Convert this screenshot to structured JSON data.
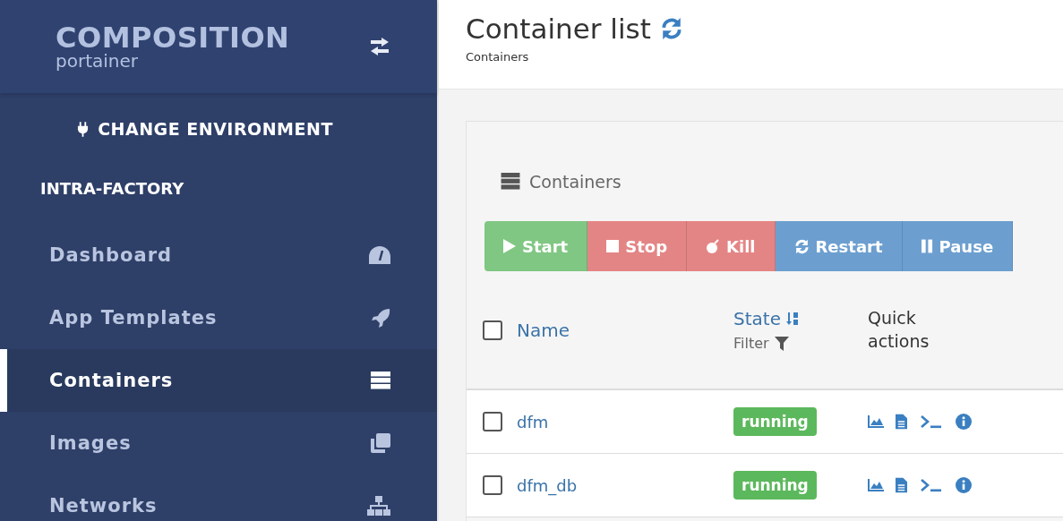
{
  "sidebar": {
    "brand": "COMPOSITION",
    "product": "portainer",
    "change_environment": "CHANGE ENVIRONMENT",
    "environment": "INTRA-FACTORY",
    "items": [
      {
        "label": "Dashboard",
        "kind": "gauge",
        "selected": false
      },
      {
        "label": "App Templates",
        "kind": "rocket",
        "selected": false
      },
      {
        "label": "Containers",
        "kind": "server",
        "selected": true
      },
      {
        "label": "Images",
        "kind": "clone",
        "selected": false
      },
      {
        "label": "Networks",
        "kind": "sitemap",
        "selected": false
      }
    ]
  },
  "header": {
    "title": "Container list",
    "breadcrumb": "Containers"
  },
  "card": {
    "title": "Containers",
    "buttons": [
      {
        "label": "Start",
        "kind": "start"
      },
      {
        "label": "Stop",
        "kind": "stop"
      },
      {
        "label": "Kill",
        "kind": "kill"
      },
      {
        "label": "Restart",
        "kind": "restart"
      },
      {
        "label": "Pause",
        "kind": "pause"
      }
    ],
    "table": {
      "select_all_checked": false,
      "columns": [
        {
          "label": "Name"
        },
        {
          "label": "State",
          "filter": "Filter"
        },
        {
          "label": "Quick actions"
        }
      ],
      "rows": [
        {
          "name": "dfm",
          "state": "running",
          "checked": false
        },
        {
          "name": "dfm_db",
          "state": "running",
          "checked": false
        }
      ]
    }
  }
}
